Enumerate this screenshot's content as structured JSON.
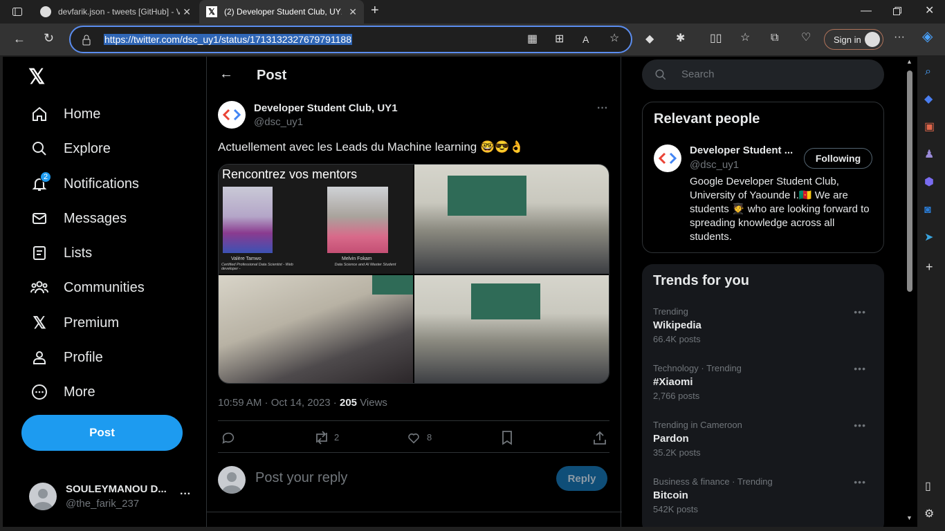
{
  "browser": {
    "tabs": [
      {
        "title": "devfarik.json - tweets [GitHub] - V",
        "icon": "github-icon"
      },
      {
        "title": "(2) Developer Student Club, UY1",
        "icon": "x-logo-icon"
      }
    ],
    "url": "https://twitter.com/dsc_uy1/status/1713132327679791188",
    "sign_in": "Sign in"
  },
  "nav": {
    "items": [
      {
        "label": "Home",
        "icon": "home-icon"
      },
      {
        "label": "Explore",
        "icon": "search-icon"
      },
      {
        "label": "Notifications",
        "icon": "bell-icon",
        "badge": "2"
      },
      {
        "label": "Messages",
        "icon": "envelope-icon"
      },
      {
        "label": "Lists",
        "icon": "list-icon"
      },
      {
        "label": "Communities",
        "icon": "people-icon"
      },
      {
        "label": "Premium",
        "icon": "x-logo-icon"
      },
      {
        "label": "Profile",
        "icon": "person-icon"
      },
      {
        "label": "More",
        "icon": "more-circle-icon"
      }
    ],
    "post_button": "Post",
    "account": {
      "name": "SOULEYMANOU D...",
      "handle": "@the_farik_237"
    }
  },
  "header": {
    "title": "Post"
  },
  "tweet": {
    "author": "Developer Student Club, UY1",
    "handle": "@dsc_uy1",
    "text": "Actuellement avec les Leads du Machine learning 🤓😎👌",
    "image1_title": "Rencontrez vos mentors",
    "mentor1": {
      "name": "Valère Tamwo",
      "role": "Certified Professional Data Scientist - Web developer -"
    },
    "mentor2": {
      "name": "Melvin Fokam",
      "role": "Data Science and AI Master Student"
    },
    "time": "10:59 AM",
    "date": "Oct 14, 2023",
    "views_count": "205",
    "views_label": "Views",
    "retweets": "2",
    "likes": "8",
    "reply_placeholder": "Post your reply",
    "reply_button": "Reply"
  },
  "search": {
    "placeholder": "Search"
  },
  "relevant": {
    "title": "Relevant people",
    "name": "Developer Student ...",
    "handle": "@dsc_uy1",
    "follow_label": "Following",
    "bio": "Google Developer Student Club, University of Yaounde I.🇨🇲 We are students 🧑‍🎓 who are looking forward to spreading knowledge across all students."
  },
  "trends": {
    "title": "Trends for you",
    "items": [
      {
        "category": "Trending",
        "name": "Wikipedia",
        "count": "66.4K posts"
      },
      {
        "category": "Technology · Trending",
        "name": "#Xiaomi",
        "count": "2,766 posts"
      },
      {
        "category": "Trending in Cameroon",
        "name": "Pardon",
        "count": "35.2K posts"
      },
      {
        "category": "Business & finance · Trending",
        "name": "Bitcoin",
        "count": "542K posts"
      }
    ]
  },
  "colors": {
    "accent": "#1d9bf0",
    "background": "#000000",
    "border": "#2f3336",
    "muted": "#71767b"
  }
}
